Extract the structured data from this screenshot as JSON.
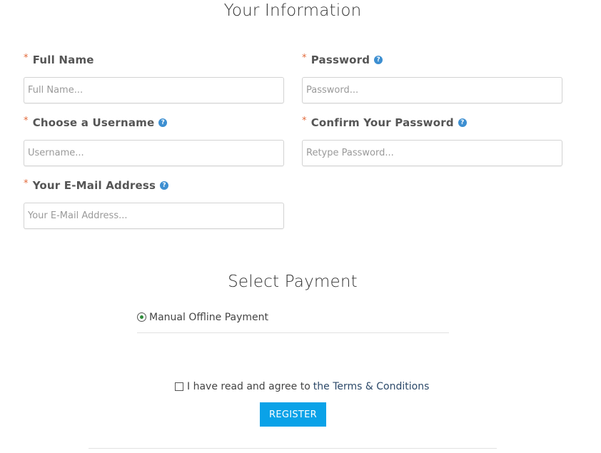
{
  "info_section": {
    "title": "Your Information"
  },
  "fields": {
    "required_marker": "*",
    "full_name": {
      "label": "Full Name",
      "placeholder": "Full Name..."
    },
    "password": {
      "label": "Password",
      "placeholder": "Password..."
    },
    "username": {
      "label": "Choose a Username",
      "placeholder": "Username..."
    },
    "confirm_password": {
      "label": "Confirm Your Password",
      "placeholder": "Retype Password..."
    },
    "email": {
      "label": "Your E-Mail Address",
      "placeholder": "Your E-Mail Address..."
    },
    "help_icon_glyph": "?"
  },
  "payment_section": {
    "title": "Select Payment",
    "options": [
      {
        "label": "Manual Offline Payment",
        "selected": true
      }
    ]
  },
  "terms": {
    "text": "I have read and agree to",
    "link_text": "the Terms & Conditions",
    "checked": false
  },
  "register": {
    "label": "REGISTER",
    "color": "#0aa2e8"
  },
  "colors": {
    "required_marker": "#e26a3b",
    "help_icon": "#3d8fd1",
    "link": "#2d4a6a"
  },
  "icons": {
    "help": "help-circle-icon",
    "radio": "radio-selected-icon",
    "checkbox": "checkbox-unchecked-icon"
  }
}
